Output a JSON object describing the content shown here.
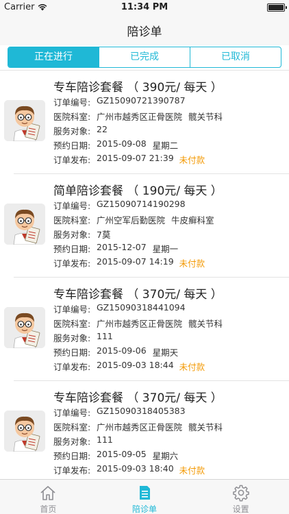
{
  "status_bar": {
    "carrier": "Carrier",
    "time": "11:34 PM"
  },
  "nav": {
    "title": "陪诊单"
  },
  "segments": [
    "正在进行",
    "已完成",
    "已取消"
  ],
  "labels": {
    "order_no": "订单编号:",
    "department": "医院科室:",
    "patient": "服务对象:",
    "appointment": "预约日期:",
    "published": "订单发布:"
  },
  "orders": [
    {
      "title": "专车陪诊套餐 （ 390元/ 每天 ）",
      "order_no": "GZ15090721390787",
      "hospital": "广州市越秀区正骨医院",
      "dept": "髋关节科",
      "patient": "22",
      "appt_date": "2015-09-08",
      "appt_weekday": "星期二",
      "published": "2015-09-07 21:39",
      "status": "未付款"
    },
    {
      "title": "简单陪诊套餐 （ 190元/ 每天 ）",
      "order_no": "GZ15090714190298",
      "hospital": "广州空军后勤医院",
      "dept": "牛皮癣科室",
      "patient": "7莫",
      "appt_date": "2015-12-07",
      "appt_weekday": "星期一",
      "published": "2015-09-07 14:19",
      "status": "未付款"
    },
    {
      "title": "专车陪诊套餐 （ 370元/ 每天 ）",
      "order_no": "GZ15090318441094",
      "hospital": "广州市越秀区正骨医院",
      "dept": "髋关节科",
      "patient": "111",
      "appt_date": "2015-09-06",
      "appt_weekday": "星期天",
      "published": "2015-09-03 18:44",
      "status": "未付款"
    },
    {
      "title": "专车陪诊套餐 （ 370元/ 每天 ）",
      "order_no": "GZ15090318405383",
      "hospital": "广州市越秀区正骨医院",
      "dept": "髋关节科",
      "patient": "111",
      "appt_date": "2015-09-05",
      "appt_weekday": "星期六",
      "published": "2015-09-03 18:40",
      "status": "未付款"
    }
  ],
  "tabs": [
    {
      "label": "首页",
      "icon": "home-icon"
    },
    {
      "label": "陪诊单",
      "icon": "document-icon"
    },
    {
      "label": "设置",
      "icon": "gear-icon"
    }
  ],
  "colors": {
    "accent": "#1fb8d6",
    "status_unpaid": "#f39800"
  }
}
